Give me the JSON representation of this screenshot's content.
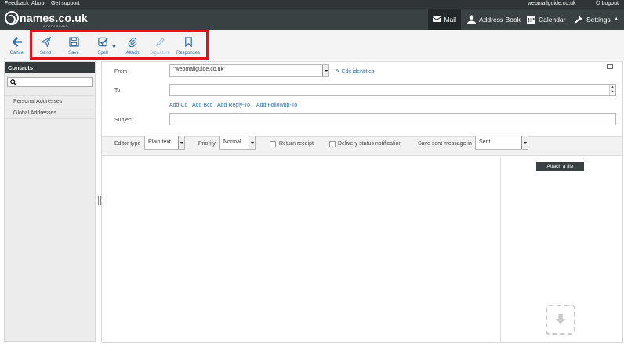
{
  "topbar": {
    "links": [
      "Feedback",
      "About",
      "Get support"
    ],
    "account": "webmailguide.co.uk",
    "logout": "Logout"
  },
  "brand": {
    "name": "names.co.uk",
    "sub": "A DADA BRAND"
  },
  "nav": {
    "mail": "Mail",
    "address_book": "Address Book",
    "calendar": "Calendar",
    "settings": "Settings"
  },
  "toolbar": {
    "cancel": "Cancel",
    "send": "Send",
    "save": "Save",
    "spell": "Spell",
    "attach": "Attach",
    "signature": "Signature",
    "responses": "Responses"
  },
  "contacts": {
    "title": "Contacts",
    "search_value": "",
    "groups": [
      "Personal Addresses",
      "Global Addresses"
    ]
  },
  "compose": {
    "from_label": "From",
    "from_value": "\"webmailguide.co.uk\"",
    "edit_identities": "Edit identities",
    "to_label": "To",
    "to_value": "",
    "add_links": [
      "Add Cc",
      "Add Bcc",
      "Add Reply-To",
      "Add Followup-To"
    ],
    "subject_label": "Subject",
    "subject_value": ""
  },
  "options": {
    "editor_type_label": "Editor type",
    "editor_type_value": "Plain text",
    "priority_label": "Priority",
    "priority_value": "Normal",
    "return_receipt": "Return receipt",
    "return_receipt_checked": false,
    "delivery_status": "Delivery status notification",
    "delivery_status_checked": false,
    "save_sent_label": "Save sent message in",
    "save_sent_value": "Sent"
  },
  "attachments": {
    "attach_button": "Attach a file"
  },
  "colors": {
    "accent": "#2c6fb0",
    "header": "#3a4143",
    "highlight": "#e3121b"
  }
}
